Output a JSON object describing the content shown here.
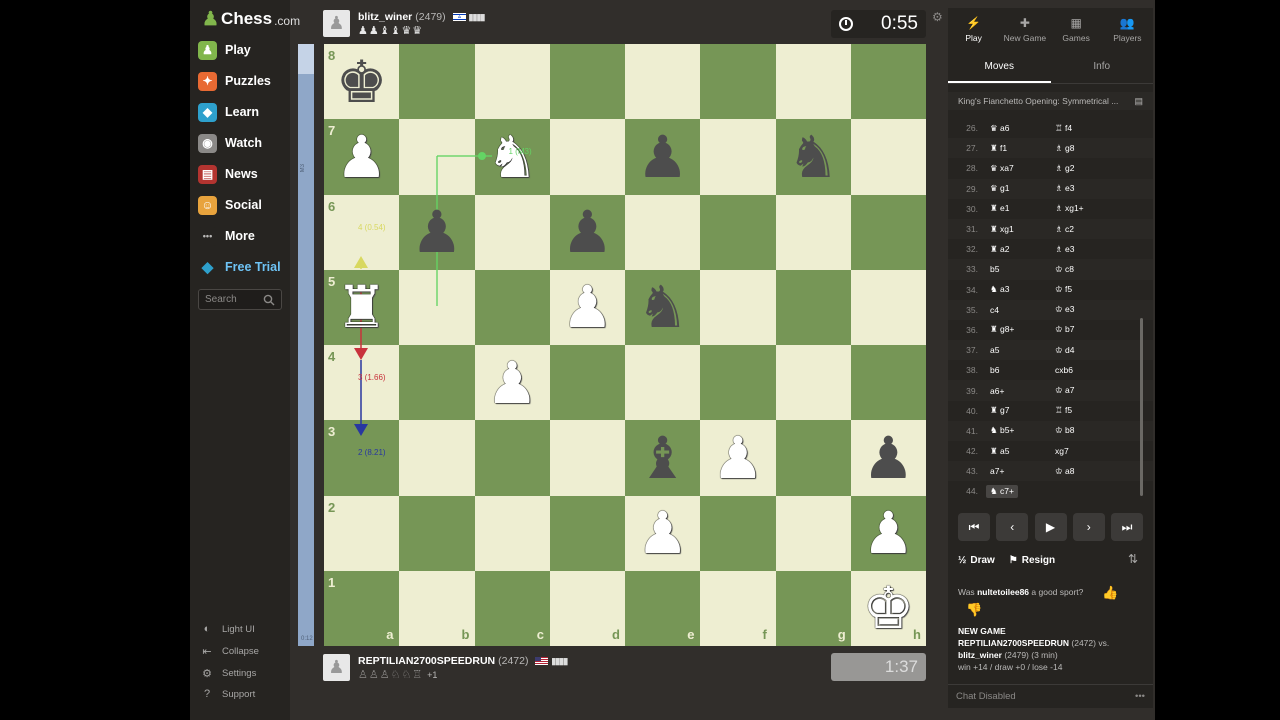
{
  "sidebar": {
    "logo_text": "Chess",
    "logo_suffix": ".com",
    "items": [
      {
        "label": "Play",
        "icon": "play-icon",
        "color": "#81b64c"
      },
      {
        "label": "Puzzles",
        "icon": "puzzle-icon",
        "color": "#e86a33"
      },
      {
        "label": "Learn",
        "icon": "learn-icon",
        "color": "#2ea0cc"
      },
      {
        "label": "Watch",
        "icon": "watch-icon",
        "color": "#8b8987"
      },
      {
        "label": "News",
        "icon": "news-icon",
        "color": "#b33430"
      },
      {
        "label": "Social",
        "icon": "social-icon",
        "color": "#e8a33d"
      },
      {
        "label": "More",
        "icon": "more-icon",
        "color": "#262421"
      },
      {
        "label": "Free Trial",
        "icon": "diamond-icon",
        "color": "#2ea0cc"
      }
    ],
    "search_placeholder": "Search",
    "footer": [
      {
        "label": "Light UI",
        "icon": "contrast-icon"
      },
      {
        "label": "Collapse",
        "icon": "collapse-icon"
      },
      {
        "label": "Settings",
        "icon": "gear-icon"
      },
      {
        "label": "Support",
        "icon": "help-icon"
      }
    ]
  },
  "top_player": {
    "name": "blitz_winer",
    "rating": "(2479)",
    "captured": "♟♟♝♝♛♛",
    "clock": "0:55"
  },
  "bottom_player": {
    "name": "REPTILIAN2700SPEEDRUN",
    "rating": "(2472)",
    "captured": "♙♙♙♘♘♖",
    "captured_plus": "+1",
    "clock": "1:37"
  },
  "eval": {
    "label_top": "M3",
    "label_bottom": "0:12"
  },
  "board": {
    "ranks": [
      "8",
      "7",
      "6",
      "5",
      "4",
      "3",
      "2",
      "1"
    ],
    "files": [
      "a",
      "b",
      "c",
      "d",
      "e",
      "f",
      "g",
      "h"
    ],
    "light_color": "#eeeed2",
    "dark_color": "#769656",
    "pieces": [
      {
        "square": "a8",
        "glyph": "♚",
        "color": "black"
      },
      {
        "square": "a7",
        "glyph": "♟",
        "color": "white"
      },
      {
        "square": "c7",
        "glyph": "♞",
        "color": "white"
      },
      {
        "square": "e7",
        "glyph": "♟",
        "color": "black"
      },
      {
        "square": "g7",
        "glyph": "♞",
        "color": "black"
      },
      {
        "square": "b6",
        "glyph": "♟",
        "color": "black"
      },
      {
        "square": "d6",
        "glyph": "♟",
        "color": "black"
      },
      {
        "square": "a5",
        "glyph": "♜",
        "color": "white"
      },
      {
        "square": "d5",
        "glyph": "♟",
        "color": "white"
      },
      {
        "square": "e5",
        "glyph": "♞",
        "color": "black"
      },
      {
        "square": "c4",
        "glyph": "♟",
        "color": "white"
      },
      {
        "square": "e3",
        "glyph": "♝",
        "color": "black"
      },
      {
        "square": "f3",
        "glyph": "♟",
        "color": "white"
      },
      {
        "square": "h3",
        "glyph": "♟",
        "color": "black"
      },
      {
        "square": "e2",
        "glyph": "♟",
        "color": "white"
      },
      {
        "square": "h2",
        "glyph": "♟",
        "color": "white"
      },
      {
        "square": "h1",
        "glyph": "♚",
        "color": "white"
      }
    ],
    "hints": [
      {
        "text": "1 (M3)",
        "square": "c7",
        "color": "#64d464"
      },
      {
        "text": "4 (0.54)",
        "square": "a6",
        "color": "#d8d860"
      },
      {
        "text": "3 (1.66)",
        "square": "a4",
        "color": "#c8323c"
      },
      {
        "text": "2 (8.21)",
        "square": "a3",
        "color": "#2837a0"
      }
    ]
  },
  "panel": {
    "tabs": [
      {
        "label": "Play",
        "icon": "bolt-icon",
        "glyph": "⚡"
      },
      {
        "label": "New Game",
        "icon": "plus-icon",
        "glyph": "✚"
      },
      {
        "label": "Games",
        "icon": "board-icon",
        "glyph": "▦"
      },
      {
        "label": "Players",
        "icon": "players-icon",
        "glyph": "👥"
      }
    ],
    "subtabs": [
      "Moves",
      "Info"
    ],
    "opening": "King's Fianchetto Opening: Symmetrical ...",
    "moves": [
      {
        "n": "26.",
        "w": "♛ a6",
        "b": "♖ f4"
      },
      {
        "n": "27.",
        "w": "♜ f1",
        "b": "♗ g8"
      },
      {
        "n": "28.",
        "w": "♛ xa7",
        "b": "♗ g2"
      },
      {
        "n": "29.",
        "w": "♛ g1",
        "b": "♗ e3"
      },
      {
        "n": "30.",
        "w": "♜ e1",
        "b": "♗ xg1+"
      },
      {
        "n": "31.",
        "w": "♜ xg1",
        "b": "♗ c2"
      },
      {
        "n": "32.",
        "w": "♜ a2",
        "b": "♗ e3"
      },
      {
        "n": "33.",
        "w": "b5",
        "b": "♔ c8"
      },
      {
        "n": "34.",
        "w": "♞ a3",
        "b": "♔ f5"
      },
      {
        "n": "35.",
        "w": "c4",
        "b": "♔ e3"
      },
      {
        "n": "36.",
        "w": "♜ g8+",
        "b": "♔ b7"
      },
      {
        "n": "37.",
        "w": "a5",
        "b": "♔ d4"
      },
      {
        "n": "38.",
        "w": "b6",
        "b": "cxb6"
      },
      {
        "n": "39.",
        "w": "a6+",
        "b": "♔ a7"
      },
      {
        "n": "40.",
        "w": "♜ g7",
        "b": "♖ f5"
      },
      {
        "n": "41.",
        "w": "♞ b5+",
        "b": "♔ b8"
      },
      {
        "n": "42.",
        "w": "♜ a5",
        "b": "xg7"
      },
      {
        "n": "43.",
        "w": "a7+",
        "b": "♔ a8"
      },
      {
        "n": "44.",
        "w": "♞ c7+",
        "b": ""
      }
    ],
    "controls": [
      "⏮",
      "‹",
      "▶",
      "›",
      "⏭"
    ],
    "draw_label": "Draw",
    "draw_icon_text": "½",
    "resign_label": "Resign",
    "sport_prefix": "Was",
    "sport_user": "nultetoilee86",
    "sport_suffix": "a good sport?",
    "new_game_title": "NEW GAME",
    "new_game_players_a": "REPTILIAN2700SPEEDRUN",
    "new_game_players_a_rating": "(2472) vs.",
    "new_game_players_b": "blitz_winer",
    "new_game_players_b_rating": "(2479) (3 min)",
    "new_game_result": "win +14 / draw +0 / lose -14",
    "chat_label": "Chat Disabled"
  }
}
